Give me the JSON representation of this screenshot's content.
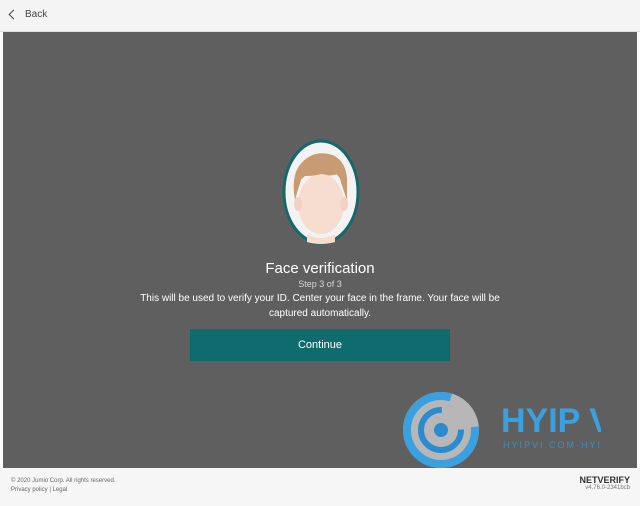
{
  "header": {
    "back_label": "Back"
  },
  "main": {
    "title": "Face verification",
    "step": "Step 3 of 3",
    "description": "This will be used to verify your ID. Center your face in the frame. Your face will be captured automatically.",
    "continue_label": "Continue"
  },
  "watermark": {
    "main_text": "HYIP VI",
    "sub_text": "HYIPVI.COM·HYIP"
  },
  "footer": {
    "copyright": "© 2020 Jumio Corp. All rights reserved.",
    "privacy_policy": "Privacy policy",
    "separator": "|",
    "legal": "Legal",
    "brand": "NETVERIFY",
    "version": "v4.76.0-2341bcb"
  },
  "colors": {
    "background": "#5f5f5f",
    "accent": "#0f6b6d",
    "watermark": "#2a8ccf"
  }
}
